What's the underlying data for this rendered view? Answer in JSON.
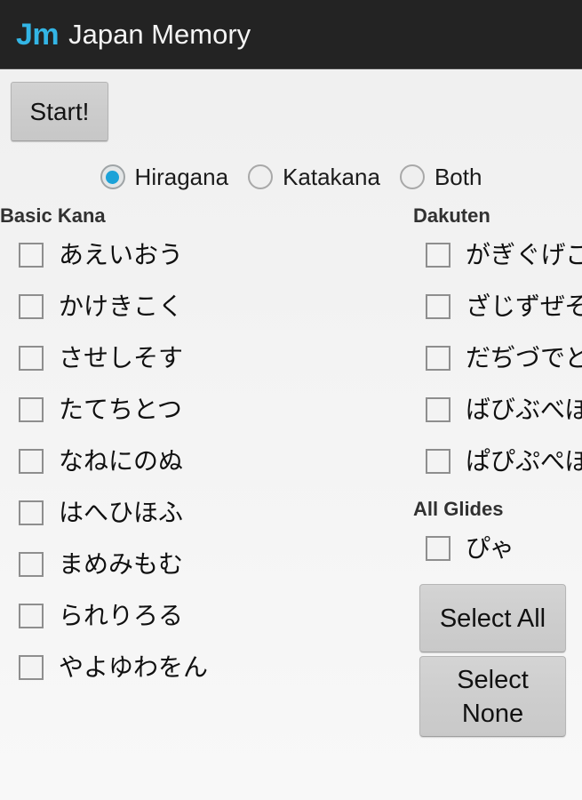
{
  "app": {
    "logo_mark": "Jm",
    "title": "Japan Memory",
    "accent_color": "#33b5e5",
    "actionbar_color": "#232323",
    "background_color": "#f2f2f2"
  },
  "controls": {
    "start_label": "Start!",
    "select_all_label": "Select All",
    "select_none_label_line1": "Select",
    "select_none_label_line2": "None"
  },
  "script_mode": {
    "selected": "Hiragana",
    "options": [
      {
        "label": "Hiragana",
        "checked": true
      },
      {
        "label": "Katakana",
        "checked": false
      },
      {
        "label": "Both",
        "checked": false
      }
    ]
  },
  "groups": [
    {
      "title": "Basic Kana",
      "column": "left",
      "rows": [
        {
          "kana": "あえいおう",
          "checked": false
        },
        {
          "kana": "かけきこく",
          "checked": false
        },
        {
          "kana": "させしそす",
          "checked": false
        },
        {
          "kana": "たてちとつ",
          "checked": false
        },
        {
          "kana": "なねにのぬ",
          "checked": false
        },
        {
          "kana": "はへひほふ",
          "checked": false
        },
        {
          "kana": "まめみもむ",
          "checked": false
        },
        {
          "kana": "られりろる",
          "checked": false
        },
        {
          "kana": "やよゆわをん",
          "checked": false
        }
      ]
    },
    {
      "title": "Dakuten",
      "column": "right",
      "rows": [
        {
          "kana": "がぎぐげご",
          "checked": false
        },
        {
          "kana": "ざじずぜぞ",
          "checked": false
        },
        {
          "kana": "だぢづでど",
          "checked": false
        },
        {
          "kana": "ばびぶべぼ",
          "checked": false
        },
        {
          "kana": "ぱぴぷぺぽ",
          "checked": false
        }
      ]
    },
    {
      "title": "All Glides",
      "column": "right",
      "rows": [
        {
          "kana": "ぴゃ",
          "checked": false
        }
      ]
    }
  ]
}
